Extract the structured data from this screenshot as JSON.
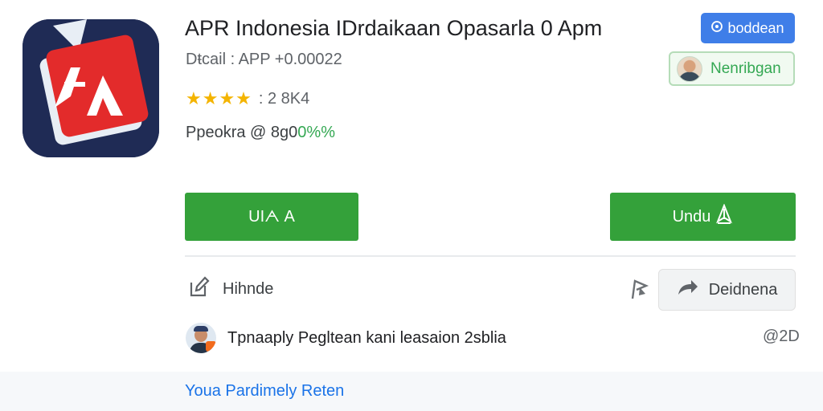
{
  "app": {
    "title": "APR Indonesia IDrdaikaan Opasarla 0  Apm",
    "subtitle": "Dŧcail : APP +0.00022",
    "rating_count": ": 2 8K4",
    "info_prefix": "Ppeokra @ 8g0",
    "info_accent": "0%%",
    "stars_filled": 4,
    "stars_display": "★★★★"
  },
  "top_button": {
    "label": "boddean",
    "icon": "circle-plus-icon"
  },
  "developer_chip": {
    "label": "Nenribgan",
    "icon": "developer-avatar"
  },
  "actions": {
    "install_left_label": "UIᗅ A",
    "install_right_label": "Undu",
    "install_right_icon": "arrow-up-icon"
  },
  "wishlist": {
    "label": "Hihnde",
    "icon": "bookmark-edit-icon"
  },
  "share": {
    "label": "Deidnena",
    "icon": "share-arrow-icon"
  },
  "review": {
    "text": "Tpnaaply Pegltean kani leasaion 2sblia",
    "count": "@2D"
  },
  "footer": {
    "link": "Youa Pardimely Reten"
  },
  "colors": {
    "green": "#34a13a",
    "blue": "#3f7ee8",
    "link": "#1a73e8",
    "star": "#f4b400",
    "icon_red": "#e32b2b",
    "icon_navy": "#1f2b55"
  }
}
